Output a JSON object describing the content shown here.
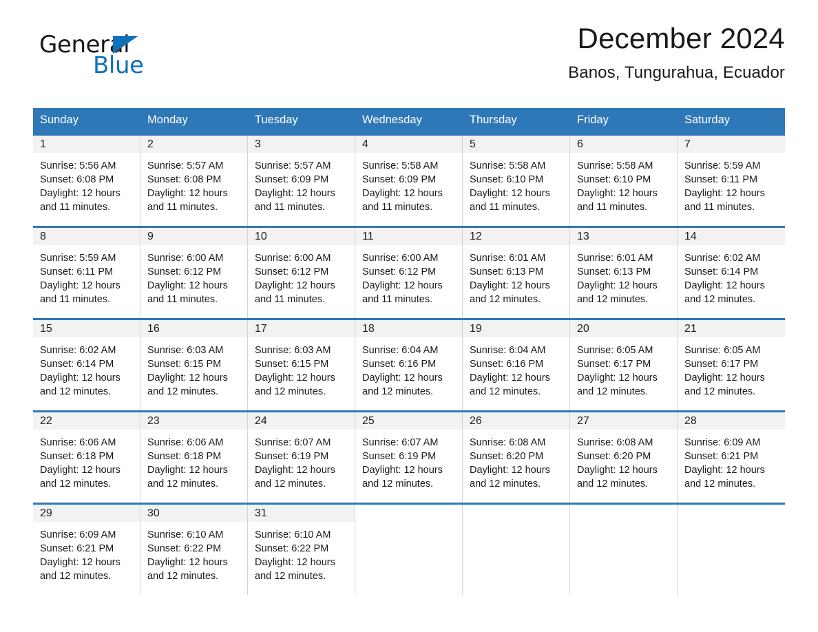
{
  "brand": {
    "name_part1": "General",
    "name_part2": "Blue",
    "logo_icon": "triangle-logo-icon",
    "accent_color": "#1072ba"
  },
  "header": {
    "title": "December 2024",
    "location": "Banos, Tungurahua, Ecuador"
  },
  "calendar": {
    "header_bg_color": "#2e78b8",
    "daynum_bg_color": "#f2f2f2",
    "weekdays": [
      "Sunday",
      "Monday",
      "Tuesday",
      "Wednesday",
      "Thursday",
      "Friday",
      "Saturday"
    ],
    "weeks": [
      [
        {
          "day": "1",
          "sunrise": "Sunrise: 5:56 AM",
          "sunset": "Sunset: 6:08 PM",
          "daylight_line1": "Daylight: 12 hours",
          "daylight_line2": "and 11 minutes."
        },
        {
          "day": "2",
          "sunrise": "Sunrise: 5:57 AM",
          "sunset": "Sunset: 6:08 PM",
          "daylight_line1": "Daylight: 12 hours",
          "daylight_line2": "and 11 minutes."
        },
        {
          "day": "3",
          "sunrise": "Sunrise: 5:57 AM",
          "sunset": "Sunset: 6:09 PM",
          "daylight_line1": "Daylight: 12 hours",
          "daylight_line2": "and 11 minutes."
        },
        {
          "day": "4",
          "sunrise": "Sunrise: 5:58 AM",
          "sunset": "Sunset: 6:09 PM",
          "daylight_line1": "Daylight: 12 hours",
          "daylight_line2": "and 11 minutes."
        },
        {
          "day": "5",
          "sunrise": "Sunrise: 5:58 AM",
          "sunset": "Sunset: 6:10 PM",
          "daylight_line1": "Daylight: 12 hours",
          "daylight_line2": "and 11 minutes."
        },
        {
          "day": "6",
          "sunrise": "Sunrise: 5:58 AM",
          "sunset": "Sunset: 6:10 PM",
          "daylight_line1": "Daylight: 12 hours",
          "daylight_line2": "and 11 minutes."
        },
        {
          "day": "7",
          "sunrise": "Sunrise: 5:59 AM",
          "sunset": "Sunset: 6:11 PM",
          "daylight_line1": "Daylight: 12 hours",
          "daylight_line2": "and 11 minutes."
        }
      ],
      [
        {
          "day": "8",
          "sunrise": "Sunrise: 5:59 AM",
          "sunset": "Sunset: 6:11 PM",
          "daylight_line1": "Daylight: 12 hours",
          "daylight_line2": "and 11 minutes."
        },
        {
          "day": "9",
          "sunrise": "Sunrise: 6:00 AM",
          "sunset": "Sunset: 6:12 PM",
          "daylight_line1": "Daylight: 12 hours",
          "daylight_line2": "and 11 minutes."
        },
        {
          "day": "10",
          "sunrise": "Sunrise: 6:00 AM",
          "sunset": "Sunset: 6:12 PM",
          "daylight_line1": "Daylight: 12 hours",
          "daylight_line2": "and 11 minutes."
        },
        {
          "day": "11",
          "sunrise": "Sunrise: 6:00 AM",
          "sunset": "Sunset: 6:12 PM",
          "daylight_line1": "Daylight: 12 hours",
          "daylight_line2": "and 11 minutes."
        },
        {
          "day": "12",
          "sunrise": "Sunrise: 6:01 AM",
          "sunset": "Sunset: 6:13 PM",
          "daylight_line1": "Daylight: 12 hours",
          "daylight_line2": "and 12 minutes."
        },
        {
          "day": "13",
          "sunrise": "Sunrise: 6:01 AM",
          "sunset": "Sunset: 6:13 PM",
          "daylight_line1": "Daylight: 12 hours",
          "daylight_line2": "and 12 minutes."
        },
        {
          "day": "14",
          "sunrise": "Sunrise: 6:02 AM",
          "sunset": "Sunset: 6:14 PM",
          "daylight_line1": "Daylight: 12 hours",
          "daylight_line2": "and 12 minutes."
        }
      ],
      [
        {
          "day": "15",
          "sunrise": "Sunrise: 6:02 AM",
          "sunset": "Sunset: 6:14 PM",
          "daylight_line1": "Daylight: 12 hours",
          "daylight_line2": "and 12 minutes."
        },
        {
          "day": "16",
          "sunrise": "Sunrise: 6:03 AM",
          "sunset": "Sunset: 6:15 PM",
          "daylight_line1": "Daylight: 12 hours",
          "daylight_line2": "and 12 minutes."
        },
        {
          "day": "17",
          "sunrise": "Sunrise: 6:03 AM",
          "sunset": "Sunset: 6:15 PM",
          "daylight_line1": "Daylight: 12 hours",
          "daylight_line2": "and 12 minutes."
        },
        {
          "day": "18",
          "sunrise": "Sunrise: 6:04 AM",
          "sunset": "Sunset: 6:16 PM",
          "daylight_line1": "Daylight: 12 hours",
          "daylight_line2": "and 12 minutes."
        },
        {
          "day": "19",
          "sunrise": "Sunrise: 6:04 AM",
          "sunset": "Sunset: 6:16 PM",
          "daylight_line1": "Daylight: 12 hours",
          "daylight_line2": "and 12 minutes."
        },
        {
          "day": "20",
          "sunrise": "Sunrise: 6:05 AM",
          "sunset": "Sunset: 6:17 PM",
          "daylight_line1": "Daylight: 12 hours",
          "daylight_line2": "and 12 minutes."
        },
        {
          "day": "21",
          "sunrise": "Sunrise: 6:05 AM",
          "sunset": "Sunset: 6:17 PM",
          "daylight_line1": "Daylight: 12 hours",
          "daylight_line2": "and 12 minutes."
        }
      ],
      [
        {
          "day": "22",
          "sunrise": "Sunrise: 6:06 AM",
          "sunset": "Sunset: 6:18 PM",
          "daylight_line1": "Daylight: 12 hours",
          "daylight_line2": "and 12 minutes."
        },
        {
          "day": "23",
          "sunrise": "Sunrise: 6:06 AM",
          "sunset": "Sunset: 6:18 PM",
          "daylight_line1": "Daylight: 12 hours",
          "daylight_line2": "and 12 minutes."
        },
        {
          "day": "24",
          "sunrise": "Sunrise: 6:07 AM",
          "sunset": "Sunset: 6:19 PM",
          "daylight_line1": "Daylight: 12 hours",
          "daylight_line2": "and 12 minutes."
        },
        {
          "day": "25",
          "sunrise": "Sunrise: 6:07 AM",
          "sunset": "Sunset: 6:19 PM",
          "daylight_line1": "Daylight: 12 hours",
          "daylight_line2": "and 12 minutes."
        },
        {
          "day": "26",
          "sunrise": "Sunrise: 6:08 AM",
          "sunset": "Sunset: 6:20 PM",
          "daylight_line1": "Daylight: 12 hours",
          "daylight_line2": "and 12 minutes."
        },
        {
          "day": "27",
          "sunrise": "Sunrise: 6:08 AM",
          "sunset": "Sunset: 6:20 PM",
          "daylight_line1": "Daylight: 12 hours",
          "daylight_line2": "and 12 minutes."
        },
        {
          "day": "28",
          "sunrise": "Sunrise: 6:09 AM",
          "sunset": "Sunset: 6:21 PM",
          "daylight_line1": "Daylight: 12 hours",
          "daylight_line2": "and 12 minutes."
        }
      ],
      [
        {
          "day": "29",
          "sunrise": "Sunrise: 6:09 AM",
          "sunset": "Sunset: 6:21 PM",
          "daylight_line1": "Daylight: 12 hours",
          "daylight_line2": "and 12 minutes."
        },
        {
          "day": "30",
          "sunrise": "Sunrise: 6:10 AM",
          "sunset": "Sunset: 6:22 PM",
          "daylight_line1": "Daylight: 12 hours",
          "daylight_line2": "and 12 minutes."
        },
        {
          "day": "31",
          "sunrise": "Sunrise: 6:10 AM",
          "sunset": "Sunset: 6:22 PM",
          "daylight_line1": "Daylight: 12 hours",
          "daylight_line2": "and 12 minutes."
        },
        {
          "day": "",
          "sunrise": "",
          "sunset": "",
          "daylight_line1": "",
          "daylight_line2": ""
        },
        {
          "day": "",
          "sunrise": "",
          "sunset": "",
          "daylight_line1": "",
          "daylight_line2": ""
        },
        {
          "day": "",
          "sunrise": "",
          "sunset": "",
          "daylight_line1": "",
          "daylight_line2": ""
        },
        {
          "day": "",
          "sunrise": "",
          "sunset": "",
          "daylight_line1": "",
          "daylight_line2": ""
        }
      ]
    ]
  }
}
